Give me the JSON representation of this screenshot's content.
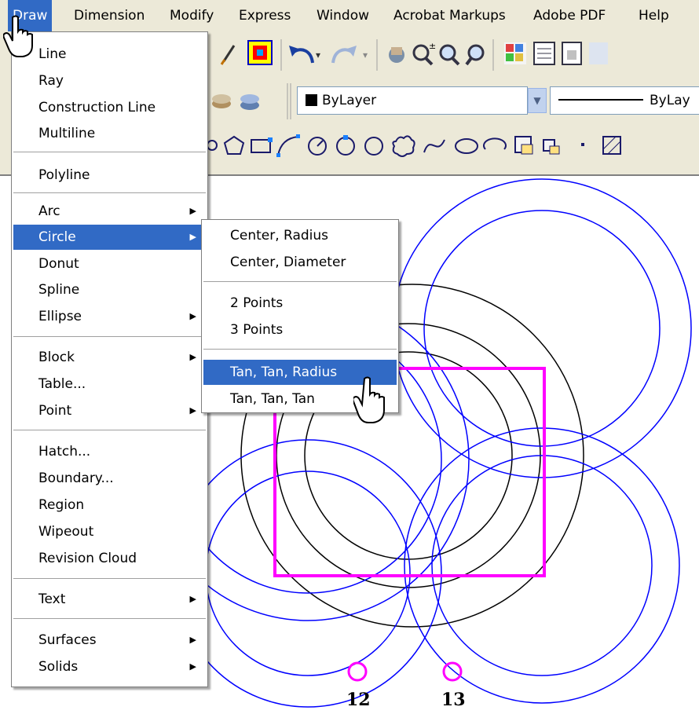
{
  "menubar": {
    "items": [
      "Draw",
      "Dimension",
      "Modify",
      "Express",
      "Window",
      "Acrobat Markups",
      "Adobe PDF",
      "Help"
    ]
  },
  "toolbar": {
    "layer_combo": "ByLayer",
    "linetype_combo": "ByLay"
  },
  "draw_menu": {
    "items": [
      "Line",
      "Ray",
      "Construction Line",
      "Multiline",
      "Polyline",
      "Arc",
      "Circle",
      "Donut",
      "Spline",
      "Ellipse",
      "Block",
      "Table...",
      "Point",
      "Hatch...",
      "Boundary...",
      "Region",
      "Wipeout",
      "Revision Cloud",
      "Text",
      "Surfaces",
      "Solids"
    ]
  },
  "circle_submenu": {
    "items": [
      "Center, Radius",
      "Center, Diameter",
      "2 Points",
      "3 Points",
      "Tan, Tan, Radius",
      "Tan, Tan, Tan"
    ]
  },
  "drawing": {
    "labels": [
      "12",
      "13"
    ],
    "colors": {
      "blue": "#0000ff",
      "magenta": "#ff00ff",
      "black": "#000000"
    }
  },
  "colors": {
    "menu_highlight": "#316ac5",
    "toolbar_bg": "#ece9d8"
  }
}
